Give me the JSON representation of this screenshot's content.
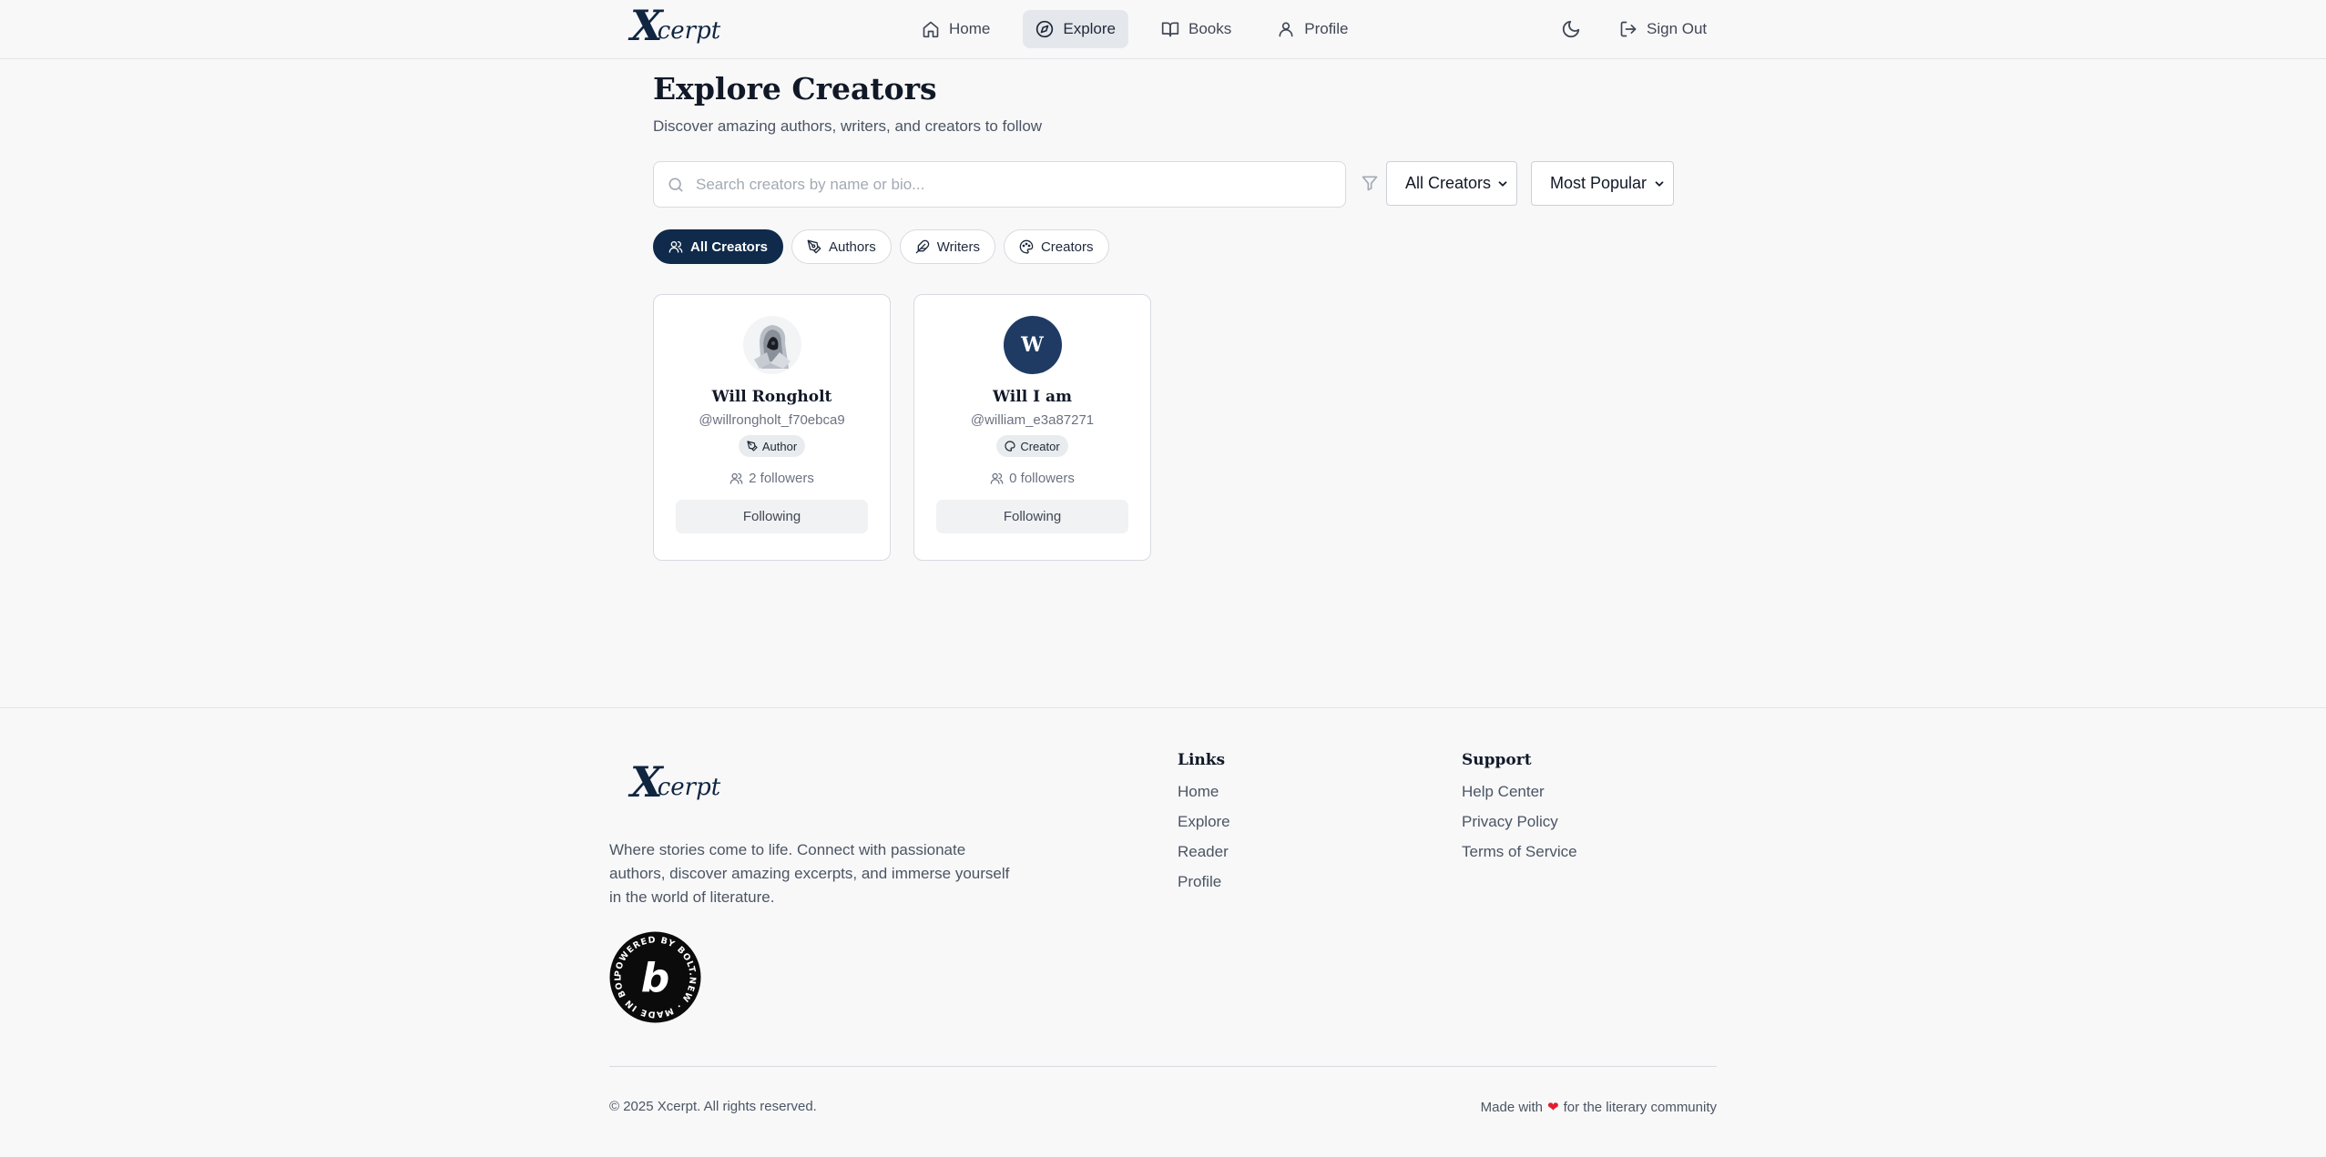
{
  "brand": {
    "logo_x": "X",
    "logo_rest": "cerpt"
  },
  "nav": {
    "items": [
      {
        "label": "Home",
        "icon": "home-icon"
      },
      {
        "label": "Explore",
        "icon": "compass-icon",
        "active": true
      },
      {
        "label": "Books",
        "icon": "book-open-icon"
      },
      {
        "label": "Profile",
        "icon": "user-icon"
      }
    ],
    "theme_toggle_icon": "moon-icon",
    "sign_out_label": "Sign Out"
  },
  "page": {
    "title": "Explore Creators",
    "subtitle": "Discover amazing authors, writers, and creators to follow"
  },
  "search": {
    "value": "",
    "placeholder": "Search creators by name or bio..."
  },
  "filters": {
    "type_selected": "All Creators",
    "sort_selected": "Most Popular"
  },
  "chips": [
    {
      "label": "All Creators",
      "icon": "users-icon",
      "active": true
    },
    {
      "label": "Authors",
      "icon": "pen-nib-icon"
    },
    {
      "label": "Writers",
      "icon": "feather-icon"
    },
    {
      "label": "Creators",
      "icon": "palette-icon"
    }
  ],
  "creators": [
    {
      "name": "Will Rongholt",
      "handle": "@willrongholt_f70ebca9",
      "role": "Author",
      "role_icon": "pen-nib-icon",
      "followers": "2 followers",
      "button_label": "Following",
      "avatar": "photo"
    },
    {
      "name": "Will I am",
      "handle": "@william_e3a87271",
      "role": "Creator",
      "role_icon": "palette-icon",
      "followers": "0 followers",
      "button_label": "Following",
      "avatar": "W"
    }
  ],
  "footer": {
    "description": "Where stories come to life. Connect with passionate authors, discover amazing excerpts, and immerse yourself in the world of literature.",
    "badge_text": "POWERED BY BOLT.NEW · MADE IN BOLT.NEW",
    "badge_letter": "b",
    "links_title": "Links",
    "links": [
      "Home",
      "Explore",
      "Reader",
      "Profile"
    ],
    "support_title": "Support",
    "support": [
      "Help Center",
      "Privacy Policy",
      "Terms of Service"
    ],
    "copyright": "© 2025 Xcerpt. All rights reserved.",
    "made_with_prefix": "Made with",
    "made_with_suffix": "for the literary community"
  },
  "colors": {
    "accent": "#0f2a4a",
    "avatar_bg": "#1f3b63",
    "heart": "#e11d2e"
  }
}
